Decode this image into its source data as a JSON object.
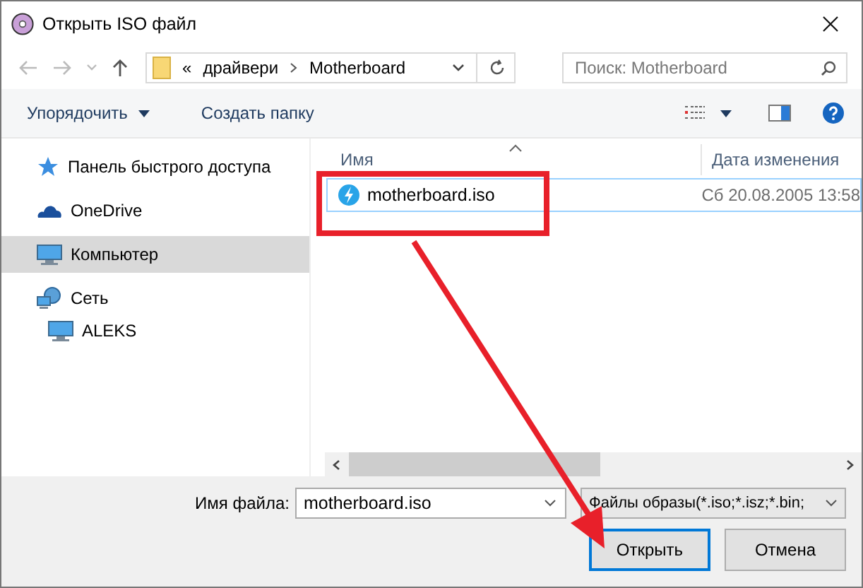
{
  "window": {
    "title": "Открыть ISO файл"
  },
  "address_bar": {
    "overflow": "«",
    "path": [
      "драйвери",
      "Motherboard"
    ]
  },
  "search": {
    "placeholder": "Поиск: Motherboard"
  },
  "toolbar": {
    "buttons": [
      {
        "label": "Упорядочить",
        "dropdown": true
      },
      {
        "label": "Создать папку",
        "dropdown": false
      }
    ]
  },
  "sidebar": {
    "items": [
      {
        "label": "Панель быстрого доступа",
        "kind": "star",
        "selected": false
      },
      {
        "label": "OneDrive",
        "kind": "cloud",
        "selected": false
      },
      {
        "label": "Компьютер",
        "kind": "computer",
        "selected": true
      },
      {
        "label": "Сеть",
        "kind": "network",
        "selected": false,
        "children": [
          {
            "label": "ALEKS",
            "kind": "computer",
            "selected": false
          }
        ]
      }
    ]
  },
  "table": {
    "columns": [
      "Имя",
      "Дата изменения"
    ],
    "rows": [
      {
        "name": "motherboard.iso",
        "date": "Сб 20.08.2005 13:58",
        "selected": true
      }
    ]
  },
  "file_name": {
    "label": "Имя файла:",
    "value": "motherboard.iso"
  },
  "file_type": {
    "value": "Файлы образы(*.iso;*.isz;*.bin;"
  },
  "buttons": [
    {
      "label": "Открыть",
      "default": true
    },
    {
      "label": "Отмена",
      "default": false
    }
  ]
}
